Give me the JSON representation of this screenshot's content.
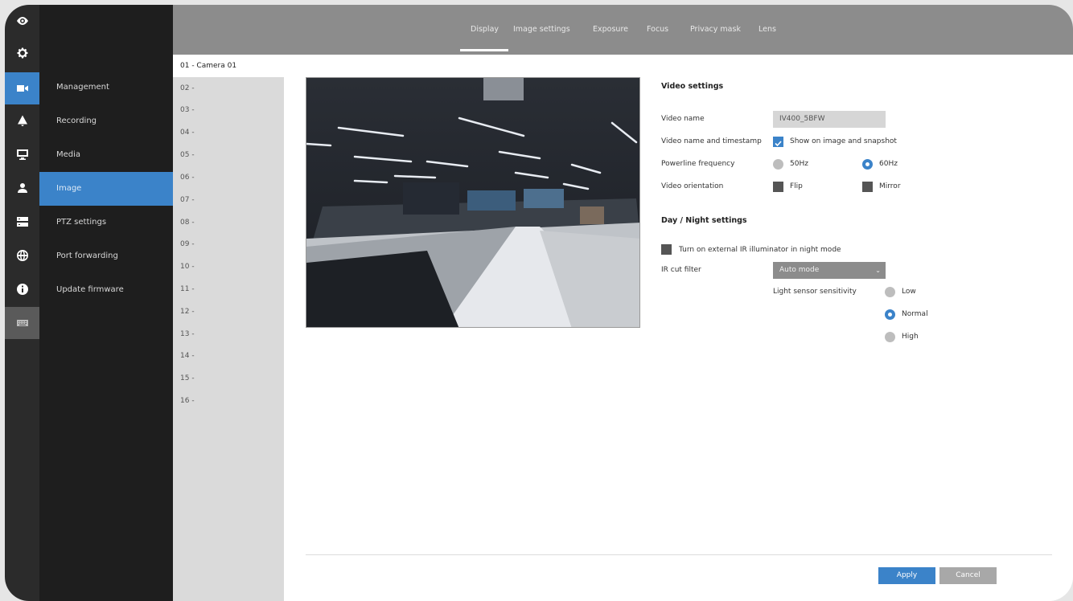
{
  "tabs": [
    "Display",
    "Image settings",
    "Exposure",
    "Focus",
    "Privacy mask",
    "Lens"
  ],
  "menu": [
    "Management",
    "Recording",
    "Media",
    "Image",
    "PTZ settings",
    "Port forwarding",
    "Update firmware"
  ],
  "rail_icons": [
    "eye-icon",
    "gear-icon",
    "camera-icon",
    "bell-icon",
    "monitor-icon",
    "user-icon",
    "storage-icon",
    "globe-icon",
    "info-icon",
    "keyboard-icon"
  ],
  "cameras": [
    "01 - Camera 01",
    "02 -",
    "03 -",
    "04 -",
    "05 -",
    "06 -",
    "07 -",
    "08 -",
    "09 -",
    "10 -",
    "11 -",
    "12 -",
    "13 -",
    "14 -",
    "15 -",
    "16 -"
  ],
  "video_settings": {
    "title": "Video settings",
    "video_name_label": "Video name",
    "video_name_value": "IV400_5BFW",
    "timestamp_label": "Video name and timestamp",
    "timestamp_option": "Show on image and snapshot",
    "powerline_label": "Powerline frequency",
    "powerline_50": "50Hz",
    "powerline_60": "60Hz",
    "orientation_label": "Video orientation",
    "flip": "Flip",
    "mirror": "Mirror"
  },
  "day_night": {
    "title": "Day / Night settings",
    "ir_illuminator": "Turn on external IR illuminator in night mode",
    "ir_cut_label": "IR cut filter",
    "ir_cut_value": "Auto mode",
    "sensitivity_label": "Light sensor sensitivity",
    "low": "Low",
    "normal": "Normal",
    "high": "High"
  },
  "buttons": {
    "apply": "Apply",
    "cancel": "Cancel"
  },
  "colors": {
    "accent": "#3b83c9",
    "sidebar": "#1e1e1e",
    "topbar": "#8c8c8c"
  }
}
